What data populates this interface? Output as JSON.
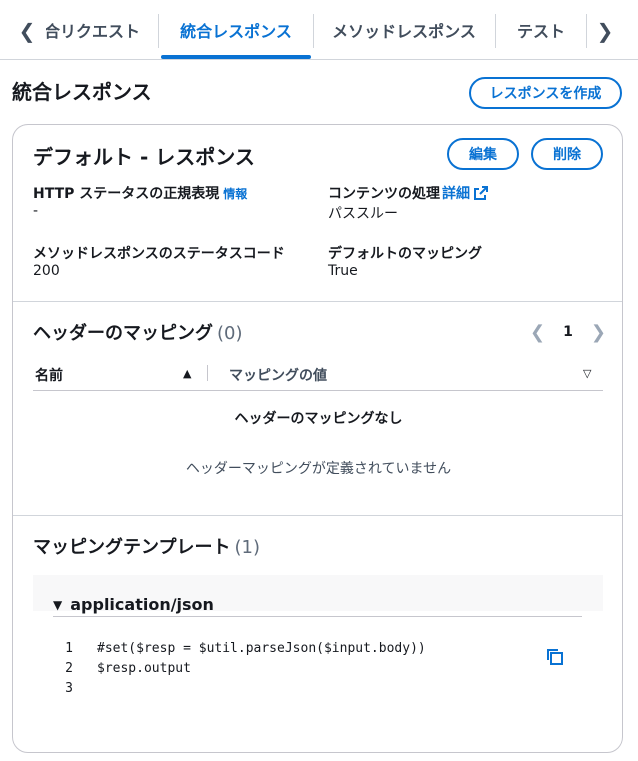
{
  "tabs": {
    "items": [
      {
        "label": "統合リクエスト"
      },
      {
        "label": "統合レスポンス"
      },
      {
        "label": "メソッドレスポンス"
      },
      {
        "label": "テスト"
      }
    ]
  },
  "page": {
    "title": "統合レスポンス",
    "create_button": "レスポンスを作成"
  },
  "card": {
    "title": "デフォルト - レスポンス",
    "edit_button": "編集",
    "delete_button": "削除",
    "fields": {
      "http_status_regex_label": "HTTP ステータスの正規表現",
      "http_status_regex_info": "情報",
      "http_status_regex_value": "-",
      "content_handling_label": "コンテンツの処理",
      "content_handling_link": "詳細",
      "content_handling_value": "パススルー",
      "method_status_code_label": "メソッドレスポンスのステータスコード",
      "method_status_code_value": "200",
      "default_mapping_label": "デフォルトのマッピング",
      "default_mapping_value": "True"
    }
  },
  "header_mappings": {
    "title": "ヘッダーのマッピング",
    "count": "(0)",
    "page": "1",
    "col_name": "名前",
    "col_value": "マッピングの値",
    "empty_title": "ヘッダーのマッピングなし",
    "empty_desc": "ヘッダーマッピングが定義されていません"
  },
  "mapping_templates": {
    "title": "マッピングテンプレート",
    "count": "(1)",
    "content_type": "application/json",
    "lines": [
      {
        "num": "1",
        "text": "#set($resp = $util.parseJson($input.body))"
      },
      {
        "num": "2",
        "text": "$resp.output"
      },
      {
        "num": "3",
        "text": ""
      }
    ]
  },
  "icons": {
    "tab_prev": "chevron-left-icon",
    "tab_next": "chevron-right-icon",
    "external": "external-link-icon",
    "copy": "copy-icon"
  },
  "colors": {
    "accent": "#0972d3",
    "text": "#16191f",
    "border": "#c6c6cd"
  }
}
